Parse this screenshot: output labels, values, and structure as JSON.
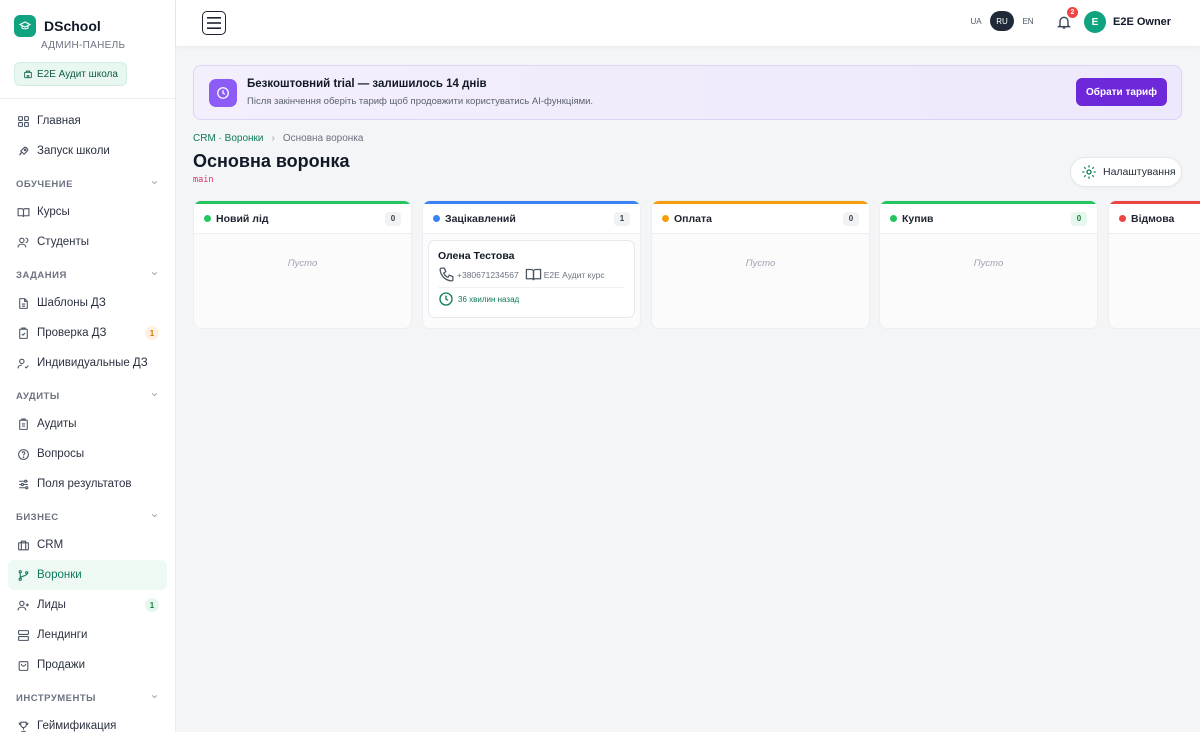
{
  "brand": {
    "name": "DSchool",
    "subtitle": "АДМИН-ПАНЕЛЬ",
    "school": "E2E Аудит школа"
  },
  "sidebar": {
    "top_items": [
      {
        "label": "Главная",
        "icon": "dashboard-icon"
      },
      {
        "label": "Запуск школи",
        "icon": "rocket-icon"
      }
    ],
    "sections": [
      {
        "title": "ОБУЧЕНИЕ",
        "items": [
          {
            "label": "Курсы"
          },
          {
            "label": "Студенты"
          }
        ]
      },
      {
        "title": "ЗАДАНИЯ",
        "items": [
          {
            "label": "Шаблоны ДЗ"
          },
          {
            "label": "Проверка ДЗ",
            "badge": "1"
          },
          {
            "label": "Индивидуальные ДЗ"
          }
        ]
      },
      {
        "title": "АУДИТЫ",
        "items": [
          {
            "label": "Аудиты"
          },
          {
            "label": "Вопросы"
          },
          {
            "label": "Поля результатов"
          }
        ]
      },
      {
        "title": "БИЗНЕС",
        "items": [
          {
            "label": "CRM"
          },
          {
            "label": "Воронки"
          },
          {
            "label": "Лиды",
            "badge": "1"
          },
          {
            "label": "Лендинги"
          },
          {
            "label": "Продажи"
          }
        ]
      },
      {
        "title": "ИНСТРУМЕНТЫ",
        "items": [
          {
            "label": "Геймификация"
          }
        ]
      }
    ]
  },
  "topbar": {
    "languages": [
      "UA",
      "RU",
      "EN"
    ],
    "selected_language": "RU",
    "notifications_count": "2",
    "user_initial": "E",
    "user_name": "E2E Owner"
  },
  "trial": {
    "title": "Безкоштовний trial — залишилось 14 днів",
    "subtitle": "Після закінчення оберіть тариф щоб продовжити користуватись AI-функціями.",
    "button": "Обрати тариф"
  },
  "breadcrumb": {
    "parent": "CRM · Воронки",
    "separator": "›",
    "current": "Основна воронка"
  },
  "page": {
    "title": "Основна воронка",
    "code": "main",
    "settings_button": "Налаштування"
  },
  "board": {
    "empty_text": "Пусто",
    "columns": [
      {
        "title": "Новий лід",
        "count": "0",
        "color": "#22c55e"
      },
      {
        "title": "Зацікавлений",
        "count": "1",
        "color": "#3b82f6"
      },
      {
        "title": "Оплата",
        "count": "0",
        "color": "#f59e0b"
      },
      {
        "title": "Купив",
        "count": "0",
        "color": "#22c55e"
      },
      {
        "title": "Відмова",
        "count": "",
        "color": "#ef4444"
      }
    ],
    "card": {
      "name": "Олена Тестова",
      "phone": "+380671234567",
      "course": "E2E Аудит курс",
      "time": "36 хвилин назад"
    }
  },
  "colors": {
    "accent": "#10a37f",
    "trial_button": "#6d28d9",
    "danger": "#ef4444"
  }
}
